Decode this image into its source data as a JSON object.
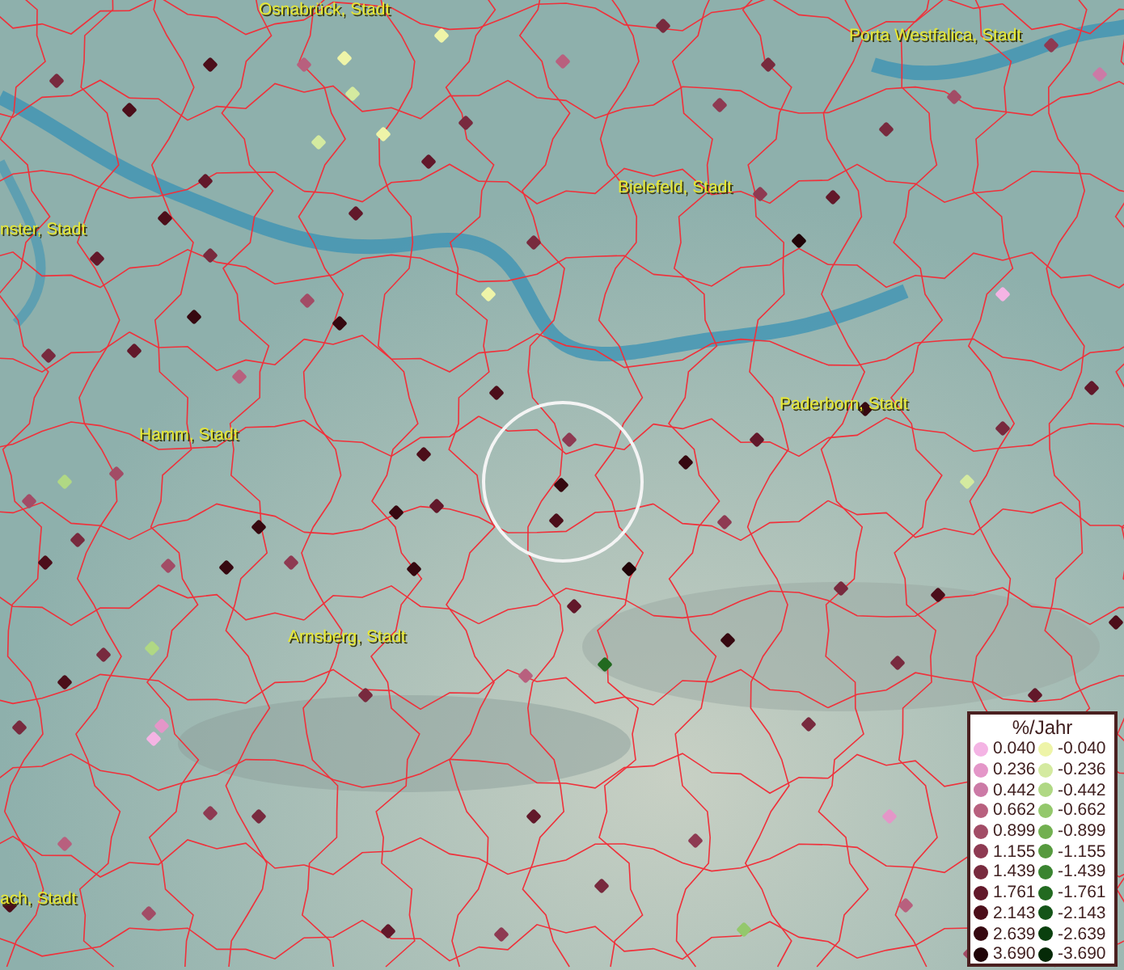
{
  "map": {
    "places": [
      {
        "name": "Osnabrück, Stadt"
      },
      {
        "name": "Porta Westfalica, Stadt"
      },
      {
        "name": "Bielefeld, Stadt"
      },
      {
        "name": "nster, Stadt"
      },
      {
        "name": "Hamm, Stadt"
      },
      {
        "name": "Paderborn, Stadt"
      },
      {
        "name": "Arnsberg, Stadt"
      },
      {
        "name": "ach, Stadt"
      }
    ]
  },
  "legend": {
    "title": "%/Jahr",
    "rows": [
      {
        "positive": {
          "value": "0.040",
          "color": "#f4b4e4"
        },
        "negative": {
          "value": "-0.040",
          "color": "#eef4a8"
        }
      },
      {
        "positive": {
          "value": "0.236",
          "color": "#e496c8"
        },
        "negative": {
          "value": "-0.236",
          "color": "#d4eaa0"
        }
      },
      {
        "positive": {
          "value": "0.442",
          "color": "#cc7aa6"
        },
        "negative": {
          "value": "-0.442",
          "color": "#b0d884"
        }
      },
      {
        "positive": {
          "value": "0.662",
          "color": "#b8607e"
        },
        "negative": {
          "value": "-0.662",
          "color": "#94c86c"
        }
      },
      {
        "positive": {
          "value": "0.899",
          "color": "#a24c66"
        },
        "negative": {
          "value": "-0.899",
          "color": "#72b050"
        }
      },
      {
        "positive": {
          "value": "1.155",
          "color": "#8e3a52"
        },
        "negative": {
          "value": "-1.155",
          "color": "#569a3e"
        }
      },
      {
        "positive": {
          "value": "1.439",
          "color": "#782a3e"
        },
        "negative": {
          "value": "-1.439",
          "color": "#3a8430"
        }
      },
      {
        "positive": {
          "value": "1.761",
          "color": "#62182a"
        },
        "negative": {
          "value": "-1.761",
          "color": "#226a20"
        }
      },
      {
        "positive": {
          "value": "2.143",
          "color": "#4c0e1a"
        },
        "negative": {
          "value": "-2.143",
          "color": "#145418"
        }
      },
      {
        "positive": {
          "value": "2.639",
          "color": "#360810"
        },
        "negative": {
          "value": "-2.639",
          "color": "#0a400e"
        }
      },
      {
        "positive": {
          "value": "3.690",
          "color": "#200408"
        },
        "negative": {
          "value": "-3.690",
          "color": "#062a08"
        }
      }
    ]
  }
}
